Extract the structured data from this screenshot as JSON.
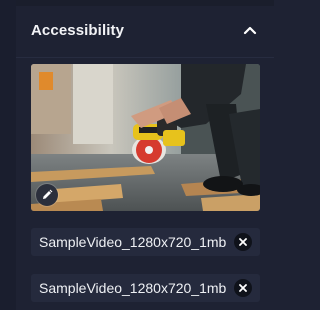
{
  "section": {
    "title": "Accessibility",
    "collapse_icon": "chevron-up-icon"
  },
  "media": {
    "thumbnail": "saw-cutting-wood-thumbnail",
    "edit_icon": "pencil-icon"
  },
  "files": [
    {
      "name": "SampleVideo_1280x720_1mb",
      "remove_icon": "close-icon"
    },
    {
      "name": "SampleVideo_1280x720_1mb",
      "remove_icon": "close-icon"
    }
  ],
  "colors": {
    "background": "#1e2233",
    "chip": "#252a3d",
    "text": "#eef0f4"
  }
}
